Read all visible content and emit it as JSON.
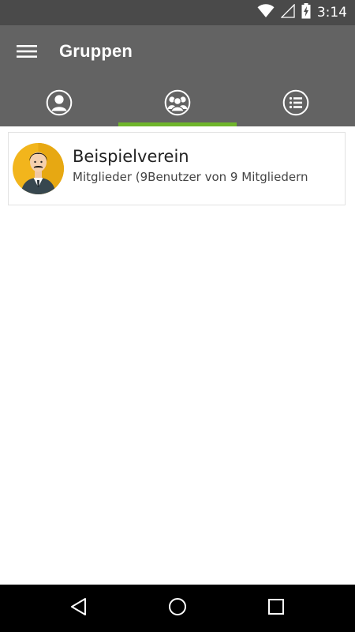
{
  "status_bar": {
    "time": "3:14",
    "icons": [
      "wifi-icon",
      "signal-icon",
      "battery-charging-icon"
    ]
  },
  "app_bar": {
    "title": "Gruppen",
    "menu_icon": "hamburger-menu-icon"
  },
  "tabs": [
    {
      "icon": "person-icon",
      "selected": false
    },
    {
      "icon": "group-icon",
      "selected": true
    },
    {
      "icon": "list-icon",
      "selected": false
    }
  ],
  "groups": [
    {
      "name": "Beispielverein",
      "subtitle": "Mitglieder (9Benutzer von 9 Mitgliedern",
      "avatar": "avatar-man-icon"
    }
  ],
  "nav_bar": {
    "icons": [
      "back-icon",
      "home-icon",
      "recents-icon"
    ]
  },
  "colors": {
    "app_bar": "#636363",
    "status_bar": "#4a4a4a",
    "accent": "#6fb52b",
    "avatar_bg": "#f2b51c"
  }
}
